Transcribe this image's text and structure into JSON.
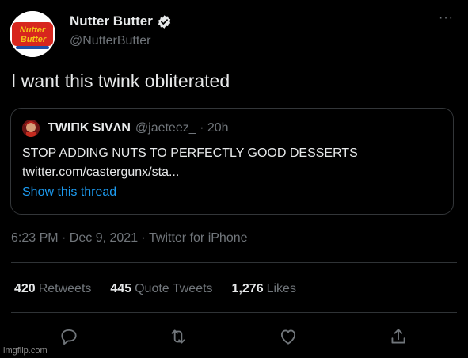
{
  "author": {
    "display_name": "Nutter Butter",
    "handle": "@NutterButter",
    "avatar_text_top": "Nutter",
    "avatar_text_bottom": "Butter",
    "more_icon": "···"
  },
  "tweet": {
    "text": "I want this twink obliterated"
  },
  "quote": {
    "display_name": "TWIΠK SIVΛN",
    "handle": "@jaeteez_ · 20h",
    "text": "STOP ADDING NUTS TO PERFECTLY GOOD DESSERTS",
    "link": "twitter.com/castergunx/sta...",
    "show_thread": "Show this thread"
  },
  "meta": {
    "time": "6:23 PM · Dec 9, 2021 · Twitter for iPhone"
  },
  "stats": {
    "retweets_count": "420",
    "retweets_label": "Retweets",
    "quotes_count": "445",
    "quotes_label": "Quote Tweets",
    "likes_count": "1,276",
    "likes_label": "Likes"
  },
  "watermark": "imgflip.com",
  "colors": {
    "background": "#000000",
    "text": "#e7e9ea",
    "muted": "#71767b",
    "link": "#1d9bf0",
    "border": "#333639",
    "verified": "#e7e9ea"
  }
}
